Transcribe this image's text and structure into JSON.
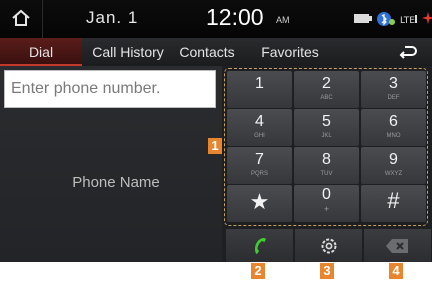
{
  "status_bar": {
    "date": "Jan. 1",
    "time": "12:00",
    "am_pm": "AM",
    "icons": [
      "home-icon",
      "battery-icon",
      "bluetooth-phone-icon",
      "signal-icon",
      "alert-icon"
    ]
  },
  "tabs": [
    {
      "label": "Dial",
      "active": true
    },
    {
      "label": "Call History",
      "active": false
    },
    {
      "label": "Contacts",
      "active": false
    },
    {
      "label": "Favorites",
      "active": false
    }
  ],
  "back_icon": "back-arrow-icon",
  "phone_input": {
    "placeholder": "Enter phone number."
  },
  "phone_name": "Phone Name",
  "keypad": [
    {
      "digit": "1",
      "letters": ""
    },
    {
      "digit": "2",
      "letters": "ABC"
    },
    {
      "digit": "3",
      "letters": "DEF"
    },
    {
      "digit": "4",
      "letters": "GHI"
    },
    {
      "digit": "5",
      "letters": "JKL"
    },
    {
      "digit": "6",
      "letters": "MNO"
    },
    {
      "digit": "7",
      "letters": "PQRS"
    },
    {
      "digit": "8",
      "letters": "TUV"
    },
    {
      "digit": "9",
      "letters": "WXYZ"
    },
    {
      "digit": "★",
      "letters": ""
    },
    {
      "digit": "0",
      "letters": "+"
    },
    {
      "digit": "#",
      "letters": ""
    }
  ],
  "bottom_buttons": [
    {
      "icon": "call-icon"
    },
    {
      "icon": "settings-icon"
    },
    {
      "icon": "delete-icon"
    }
  ],
  "markers": [
    "1",
    "2",
    "3",
    "4"
  ],
  "colors": {
    "accent_red": "#c0392b",
    "call_green": "#3ecf2e",
    "marker_orange": "#e8852f"
  }
}
